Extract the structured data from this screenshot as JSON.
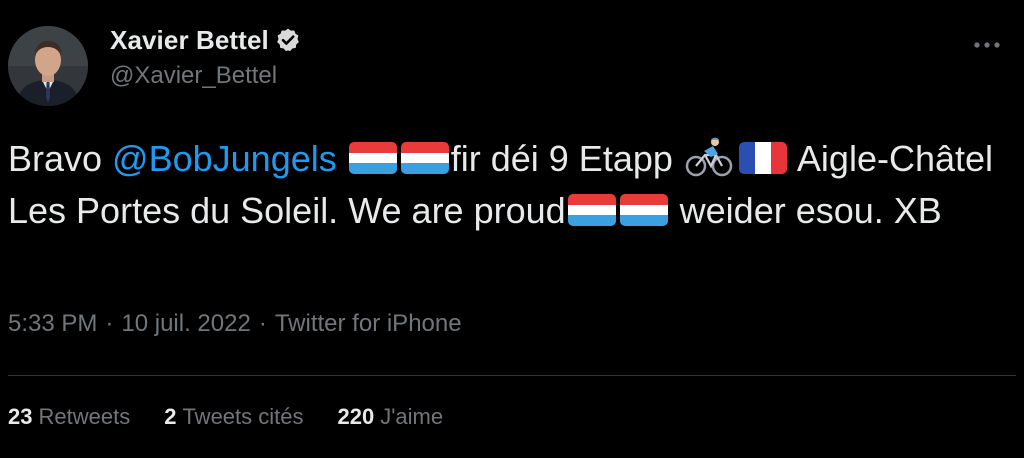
{
  "author": {
    "display_name": "Xavier Bettel",
    "handle": "@Xavier_Bettel",
    "verified": true,
    "avatar_icon": "profile-photo"
  },
  "menu": {
    "icon": "more-dots-icon",
    "glyph": "···"
  },
  "tweet": {
    "t1": "Bravo ",
    "mention": "@BobJungels",
    "t2": "fir déi 9 Etapp",
    "t3": " Aigle-Châtel Les Portes du Soleil. We are proud",
    "t4": " weider esou. XB",
    "emoji": [
      "flag-luxembourg-icon",
      "flag-luxembourg-icon",
      "bicyclist-icon",
      "flag-france-icon",
      "flag-luxembourg-icon",
      "flag-luxembourg-icon"
    ]
  },
  "meta": {
    "time": "5:33 PM",
    "sep": "·",
    "date": "10 juil. 2022",
    "source": "Twitter for iPhone"
  },
  "stats": [
    {
      "num": "23",
      "label": "Retweets"
    },
    {
      "num": "2",
      "label": "Tweets cités"
    },
    {
      "num": "220",
      "label": "J'aime"
    }
  ],
  "colors": {
    "background": "#000000",
    "text": "#e7e9ea",
    "muted": "#71767b",
    "link": "#1d9bf0",
    "verified": "#d9d9d9"
  }
}
